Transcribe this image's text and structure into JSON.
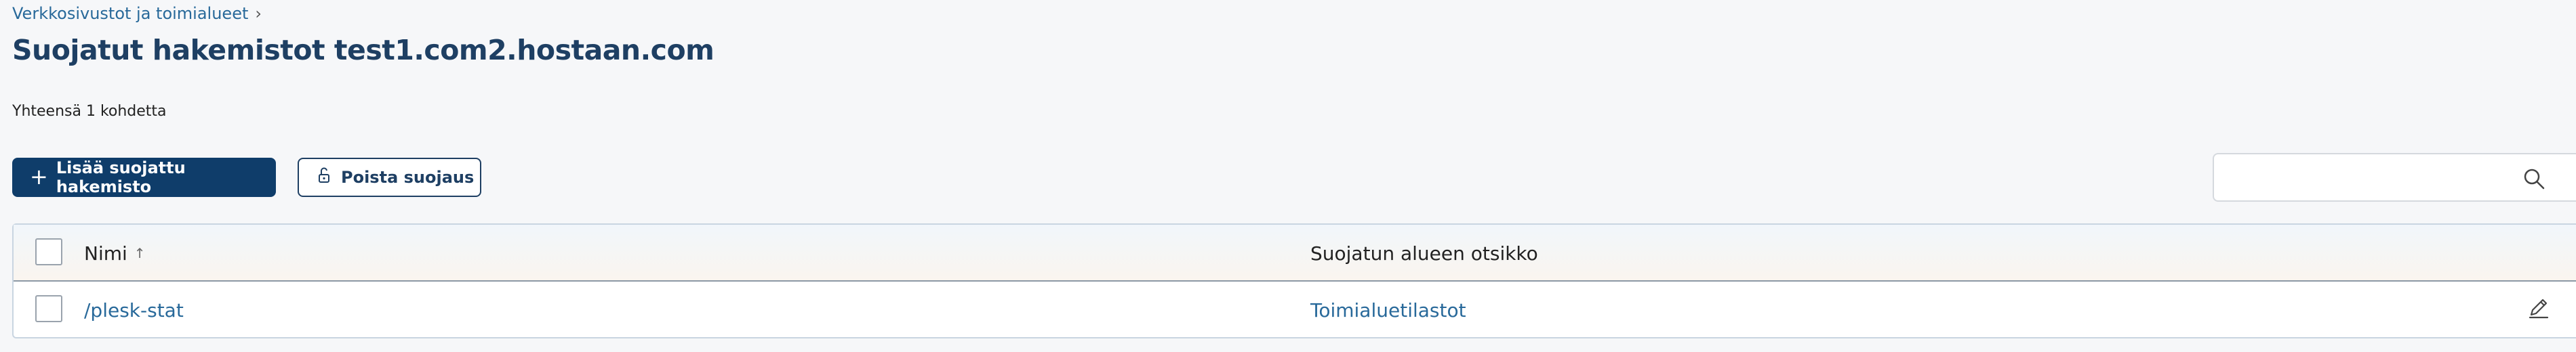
{
  "breadcrumb": {
    "parent": "Verkkosivustot ja toimialueet"
  },
  "page": {
    "title": "Suojatut hakemistot test1.com2.hostaan.com"
  },
  "summary": {
    "total": "Yhteensä 1 kohdetta"
  },
  "toolbar": {
    "add_label": "Lisää suojattu hakemisto",
    "remove_label": "Poista suojaus"
  },
  "search": {
    "value": "",
    "placeholder": ""
  },
  "table": {
    "columns": {
      "name": "Nimi",
      "title": "Suojatun alueen otsikko"
    },
    "sort": {
      "column": "name",
      "direction": "ascending"
    },
    "rows": [
      {
        "name": "/plesk-stat",
        "title": "Toimialuetilastot"
      }
    ]
  },
  "colors": {
    "primary": "#0f3d6a",
    "title": "#1e3f63",
    "link": "#28699a",
    "background": "#f6f7f9"
  },
  "icons": {
    "breadcrumb_separator": "chevron-right-icon",
    "add": "plus-icon",
    "remove": "unlock-icon",
    "search": "search-icon",
    "row_action": "edit-pencil-icon"
  }
}
